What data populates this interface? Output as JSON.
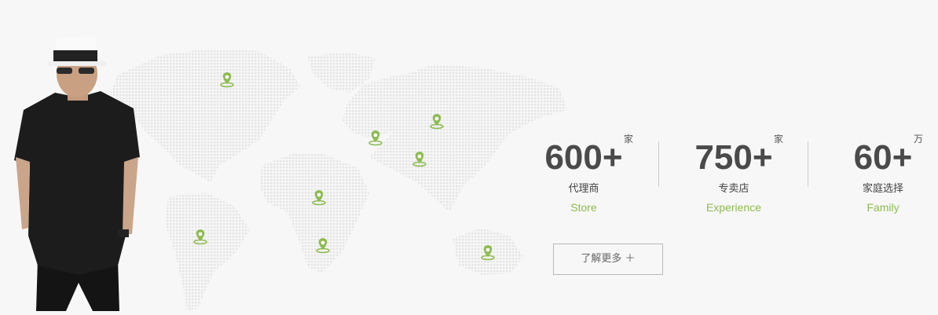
{
  "stats": [
    {
      "number": "600+",
      "unit": "家",
      "label_cn": "代理商",
      "label_en": "Store"
    },
    {
      "number": "750+",
      "unit": "家",
      "label_cn": "专卖店",
      "label_en": "Experience"
    },
    {
      "number": "60+",
      "unit": "万",
      "label_cn": "家庭选择",
      "label_en": "Family"
    }
  ],
  "more_button": {
    "label": "了解更多 ＋"
  },
  "colors": {
    "accent": "#8dbb4f",
    "number": "#4a4a4a",
    "map_dots": "#e6e6e6",
    "background": "#f7f7f7"
  },
  "map": {
    "pin_icon": "map-pin-icon",
    "pin_count": 8
  }
}
